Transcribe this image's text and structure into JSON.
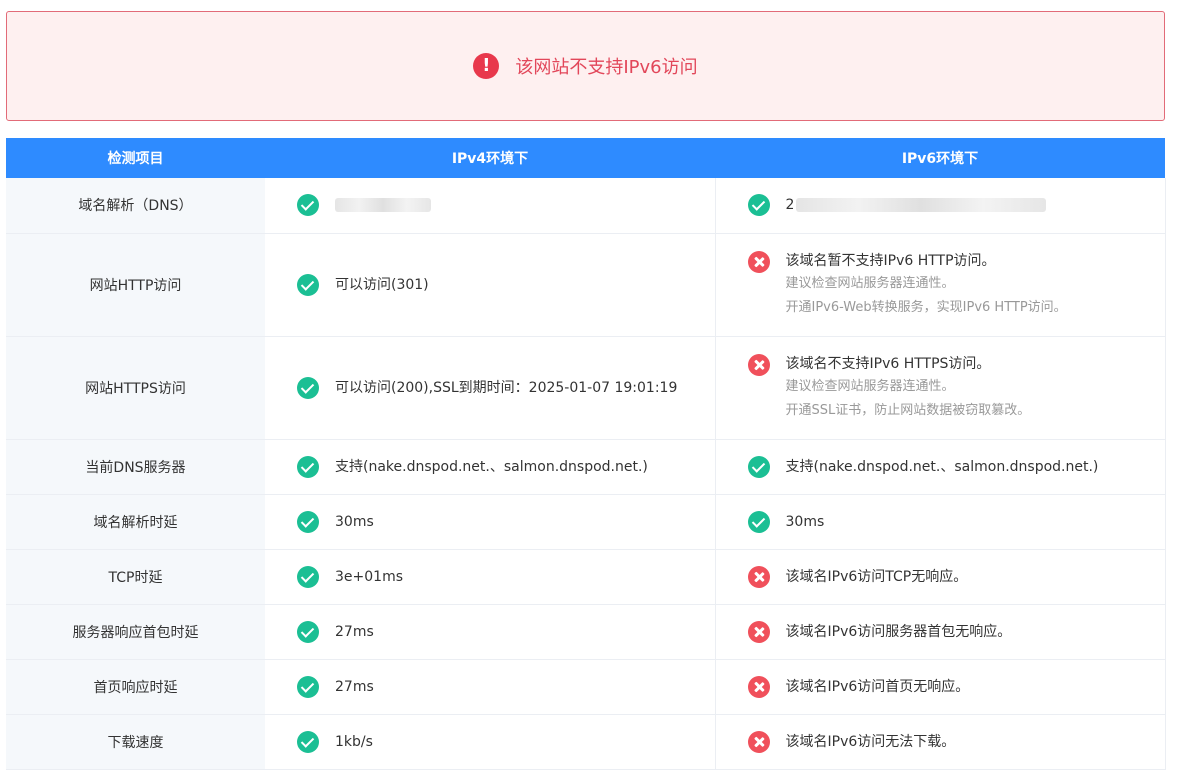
{
  "alert": {
    "icon": "exclamation-icon",
    "glyph": "!",
    "text": "该网站不支持IPv6访问"
  },
  "table": {
    "headers": {
      "item": "检测项目",
      "v4": "IPv4环境下",
      "v6": "IPv6环境下"
    },
    "rows": [
      {
        "item": "域名解析（DNS）",
        "v4": {
          "status": "ok",
          "text": ""
        },
        "v6": {
          "status": "ok",
          "text": "2"
        }
      },
      {
        "item": "网站HTTP访问",
        "v4": {
          "status": "ok",
          "text": "可以访问(301)"
        },
        "v6": {
          "status": "bad",
          "text": "该域名暂不支持IPv6 HTTP访问。",
          "sub1": "建议检查网站服务器连通性。",
          "sub2": "开通IPv6-Web转换服务，实现IPv6 HTTP访问。"
        }
      },
      {
        "item": "网站HTTPS访问",
        "v4": {
          "status": "ok",
          "text": "可以访问(200),SSL到期时间：2025-01-07 19:01:19"
        },
        "v6": {
          "status": "bad",
          "text": "该域名不支持IPv6 HTTPS访问。",
          "sub1": "建议检查网站服务器连通性。",
          "sub2": "开通SSL证书，防止网站数据被窃取篡改。"
        }
      },
      {
        "item": "当前DNS服务器",
        "v4": {
          "status": "ok",
          "text": "支持(nake.dnspod.net.、salmon.dnspod.net.)"
        },
        "v6": {
          "status": "ok",
          "text": "支持(nake.dnspod.net.、salmon.dnspod.net.)"
        }
      },
      {
        "item": "域名解析时延",
        "v4": {
          "status": "ok",
          "text": "30ms"
        },
        "v6": {
          "status": "ok",
          "text": "30ms"
        }
      },
      {
        "item": "TCP时延",
        "v4": {
          "status": "ok",
          "text": "3e+01ms"
        },
        "v6": {
          "status": "bad",
          "text": "该域名IPv6访问TCP无响应。"
        }
      },
      {
        "item": "服务器响应首包时延",
        "v4": {
          "status": "ok",
          "text": "27ms"
        },
        "v6": {
          "status": "bad",
          "text": "该域名IPv6访问服务器首包无响应。"
        }
      },
      {
        "item": "首页响应时延",
        "v4": {
          "status": "ok",
          "text": "27ms"
        },
        "v6": {
          "status": "bad",
          "text": "该域名IPv6访问首页无响应。"
        }
      },
      {
        "item": "下载速度",
        "v4": {
          "status": "ok",
          "text": "1kb/s"
        },
        "v6": {
          "status": "bad",
          "text": "该域名IPv6访问无法下载。"
        }
      }
    ]
  },
  "colors": {
    "header_bg": "#2e8bff",
    "ok": "#1bbf94",
    "bad": "#f0505b",
    "alert_text": "#e2475a"
  }
}
